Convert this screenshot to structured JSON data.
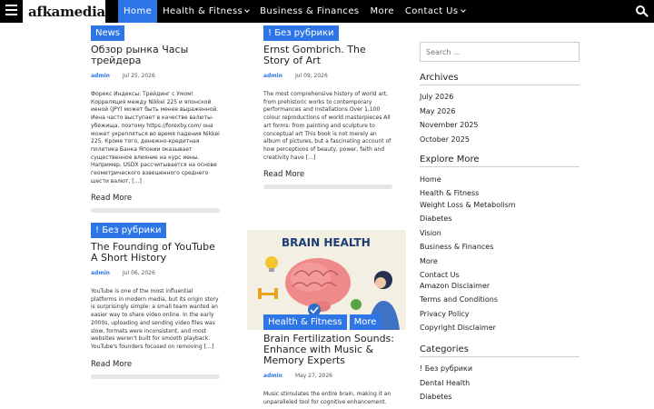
{
  "header": {
    "logo": "afkamedia",
    "nav": [
      {
        "label": "Home",
        "active": true,
        "dropdown": false
      },
      {
        "label": "Health & Fitness",
        "active": false,
        "dropdown": true
      },
      {
        "label": "Business & Finances",
        "active": false,
        "dropdown": false
      },
      {
        "label": "More",
        "active": false,
        "dropdown": false
      },
      {
        "label": "Contact Us",
        "active": false,
        "dropdown": true
      }
    ],
    "accent": "#2e76e8"
  },
  "posts": [
    {
      "categories": [
        "News"
      ],
      "title": "Обзор рынка Часы трейдера",
      "author": "admin",
      "date": "Jul 25, 2026",
      "excerpt": "Форекс Индексы: Трейдинг с Умом! Корреляция между Nikkei 225 и японской иеной (JPY) может быть менее выраженной. Иена часто выступает в качестве валюты-убежища, поэтому https://forexby.com/ она может укрепляться во время падения Nikkei 225. Кроме того, денежно-кредитная политика Банка Японии оказывает существенное влияние на курс иены. Например, USDX рассчитывается на основе геометрического взвешенного среднего шести валют, […]",
      "read_more": "Read More"
    },
    {
      "categories": [
        "! Без рубрики"
      ],
      "title": "Ernst Gombrich. The Story of Art",
      "author": "admin",
      "date": "Jul 09, 2026",
      "excerpt": "The most comprehensive history of world art, from prehistoric works to contemporary performances and installations Over 1,100 colour reproductions of world masterpieces All art forms: from painting and sculpture to conceptual art This book is not merely an album of pictures, but a fascinating account of how perceptions of beauty, power, faith and creativity have […]",
      "read_more": "Read More"
    },
    {
      "categories": [
        "! Без рубрики"
      ],
      "title": "The Founding of YouTube A Short History",
      "author": "admin",
      "date": "Jul 06, 2026",
      "excerpt": "YouTube is one of the most influential platforms in modern media, but its origin story is surprisingly simple: a small team wanted an easier way to share video online. In the early 2000s, uploading and sending video files was slow, formats were inconsistent, and most websites weren't built for smooth playback. YouTube's founders focused on removing […]",
      "read_more": "Read More"
    },
    {
      "image_text": "BRAIN HEALTH",
      "categories": [
        "Health & Fitness",
        "More"
      ],
      "title": "Brain Fertilization Sounds: Enhance with Music & Memory Experts",
      "author": "admin",
      "date": "May 27, 2026",
      "excerpt": "Music stimulates the entire brain, making it an unparalleled tool for cognitive enhancement."
    }
  ],
  "sidebar": {
    "search_placeholder": "Search ...",
    "archives_title": "Archives",
    "archives": [
      "July 2026",
      "May 2026",
      "November 2025",
      "October 2025"
    ],
    "explore_title": "Explore More",
    "explore": [
      "Home",
      "Health & Fitness",
      "Weight Loss & Metabolism",
      "Diabetes",
      "Vision",
      "Business & Finances",
      "More",
      "Contact Us",
      "Amazon Disclaimer",
      "Terms and Conditions",
      "Privacy Policy",
      "Copyright Disclaimer"
    ],
    "categories_title": "Categories",
    "categories": [
      "! Без рубрики",
      "Dental Health",
      "Diabetes"
    ]
  }
}
